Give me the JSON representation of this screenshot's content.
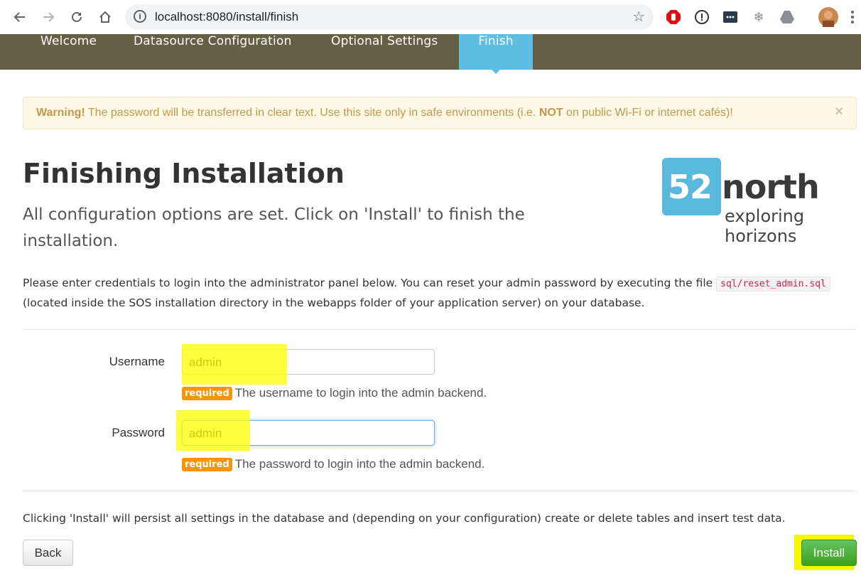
{
  "browser": {
    "url": "localhost:8080/install/finish",
    "icons": [
      "back-arrow-icon",
      "forward-arrow-icon",
      "reload-icon",
      "home-icon",
      "info-icon",
      "star-icon"
    ]
  },
  "nav": {
    "tabs": [
      {
        "label": "Welcome"
      },
      {
        "label": "Datasource Configuration"
      },
      {
        "label": "Optional Settings"
      },
      {
        "label": "Finish",
        "active": true
      }
    ],
    "bg_color": "#636045",
    "active_color": "#5fbfe0"
  },
  "warning": {
    "strong": "Warning!",
    "text_before": " The password will be transferred in clear text. Use this site only in safe environments (i.e. ",
    "emph": "NOT",
    "text_after": " on public Wi-Fi or internet cafés)!",
    "close": "×"
  },
  "page": {
    "title": "Finishing Installation",
    "subtitle": "All configuration options are set. Click on 'Install' to finish the installation.",
    "intro_before": "Please enter credentials to login into the administrator panel below. You can reset your admin password by executing the file ",
    "intro_code": "sql/reset_admin.sql",
    "intro_after": " (located inside the SOS installation directory in the webapps folder of your application server) on your database."
  },
  "logo": {
    "number": "52",
    "word": "north",
    "tagline": "exploring horizons"
  },
  "form": {
    "username_label": "Username",
    "username_value": "admin",
    "username_badge": "required",
    "username_help": "The username to login into the admin backend.",
    "password_label": "Password",
    "password_value": "admin",
    "password_badge": "required",
    "password_help": "The password to login into the admin backend."
  },
  "footer": {
    "note": "Clicking 'Install' will persist all settings in the database and (depending on your configuration) create or delete tables and insert test data.",
    "back_label": "Back",
    "install_label": "Install"
  }
}
